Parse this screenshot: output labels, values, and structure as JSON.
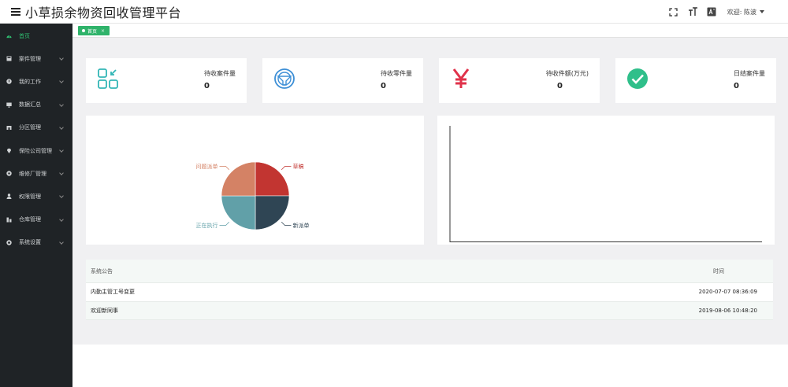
{
  "header": {
    "title": "小草损余物资回收管理平台",
    "welcome": "欢迎: 陈波",
    "icons": [
      "fullscreen-icon",
      "font-size-icon",
      "translate-icon"
    ]
  },
  "sidebar": {
    "items": [
      {
        "label": "首页",
        "icon": "dashboard-icon",
        "active": true
      },
      {
        "label": "案件管理",
        "icon": "case-icon"
      },
      {
        "label": "我的工作",
        "icon": "work-icon"
      },
      {
        "label": "数据汇总",
        "icon": "monitor-icon"
      },
      {
        "label": "分区管理",
        "icon": "region-icon"
      },
      {
        "label": "保险公司管理",
        "icon": "location-icon"
      },
      {
        "label": "维修厂管理",
        "icon": "repair-icon"
      },
      {
        "label": "权限管理",
        "icon": "user-icon"
      },
      {
        "label": "仓库管理",
        "icon": "warehouse-icon"
      },
      {
        "label": "系统设置",
        "icon": "settings-icon"
      }
    ]
  },
  "tabs": [
    {
      "label": "首页"
    }
  ],
  "stats": [
    {
      "label": "待收案件量",
      "value": "0",
      "icon": "apps-icon",
      "color": "#33b6b6"
    },
    {
      "label": "待收零件量",
      "value": "0",
      "icon": "steering-wheel-icon",
      "color": "#3d8fd6"
    },
    {
      "label": "待收件额(万元)",
      "value": "0",
      "icon": "yen-icon",
      "color": "#e0324a"
    },
    {
      "label": "日结案件量",
      "value": "0",
      "icon": "check-circle-icon",
      "color": "#2fbf8a"
    }
  ],
  "chart_data": {
    "type": "pie",
    "categories": [
      "草稿",
      "新派单",
      "正在执行",
      "问题派单"
    ],
    "values": [
      25,
      25,
      25,
      25
    ],
    "colors": [
      "#c23531",
      "#2f4554",
      "#61a0a8",
      "#d48265"
    ]
  },
  "notices": {
    "header_title": "系统公告",
    "header_time": "时间",
    "rows": [
      {
        "title": "内勤主管工号变更",
        "time": "2020-07-07 08:36:09"
      },
      {
        "title": "欢迎新同事",
        "time": "2019-08-06 10:48:20"
      }
    ]
  }
}
